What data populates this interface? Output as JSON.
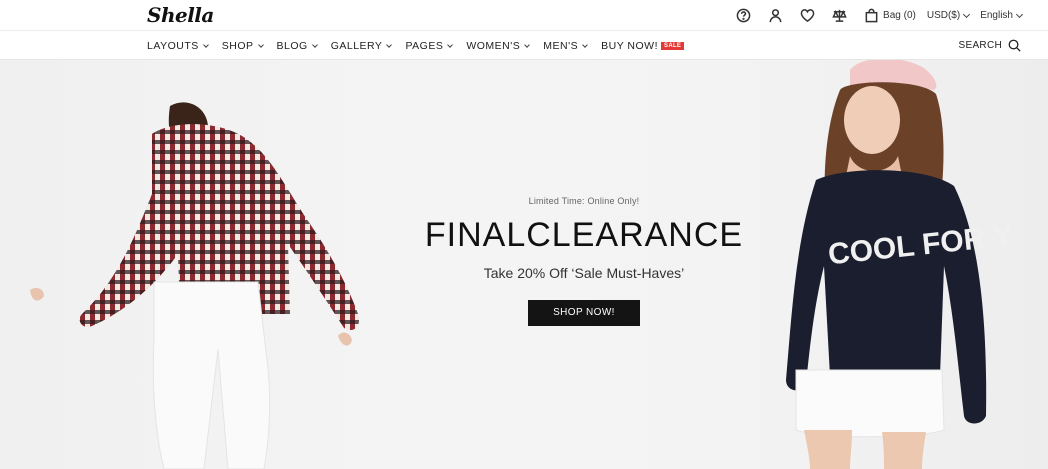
{
  "brand": {
    "logo": "Shella"
  },
  "header": {
    "icons": [
      "help-icon",
      "account-icon",
      "wishlist-icon",
      "compare-icon",
      "bag-icon"
    ],
    "bag_label": "Bag (0)",
    "currency": "USD($)",
    "language": "English"
  },
  "nav": {
    "items": [
      {
        "label": "LAYOUTS"
      },
      {
        "label": "SHOP"
      },
      {
        "label": "BLOG"
      },
      {
        "label": "GALLERY"
      },
      {
        "label": "PAGES"
      },
      {
        "label": "WOMEN'S"
      },
      {
        "label": "MEN'S"
      }
    ],
    "buy_now": "BUY NOW!",
    "sale_badge": "SALE",
    "search_label": "SEARCH"
  },
  "hero": {
    "eyebrow": "Limited Time: Online Only!",
    "headline": "FINALCLEARANCE",
    "subline": "Take 20% Off ‘Sale Must-Haves’",
    "cta": "SHOP NOW!",
    "sweater_text": "COOL FOR YOU"
  },
  "colors": {
    "sale_badge": "#e53935",
    "cta_bg": "#141414",
    "hero_bg": "#f2f2f2"
  }
}
